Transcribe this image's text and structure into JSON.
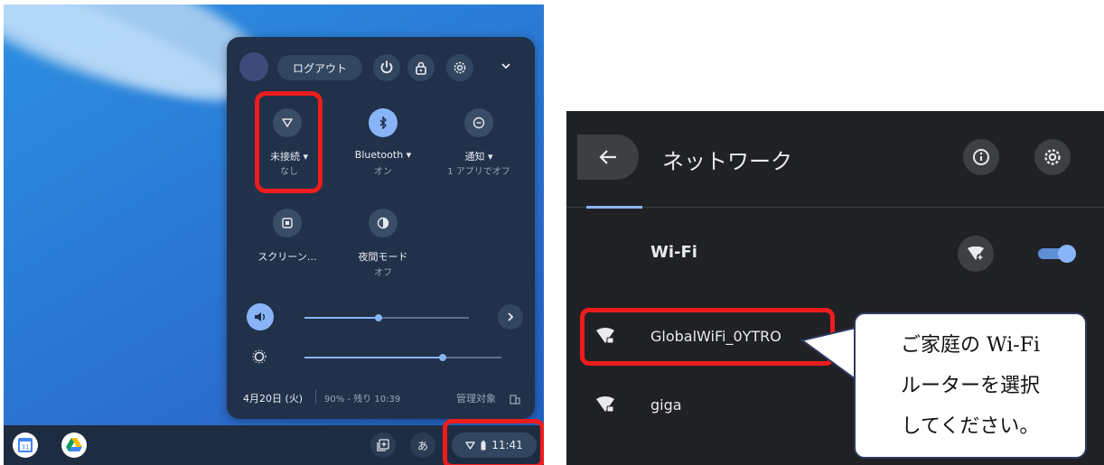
{
  "left_panel": {
    "header": {
      "logout_label": "ログアウト",
      "icons": [
        "avatar",
        "power-icon",
        "lock-icon",
        "gear-icon",
        "chevron-down-icon"
      ]
    },
    "tiles": [
      {
        "label": "未接続 ▾",
        "sub": "なし",
        "icon": "wifi-icon",
        "active": false
      },
      {
        "label": "Bluetooth ▾",
        "sub": "オン",
        "icon": "bluetooth-icon",
        "active": true
      },
      {
        "label": "通知 ▾",
        "sub": "1 アプリでオフ",
        "icon": "notifications-off-icon",
        "active": false
      },
      {
        "label": "スクリーン…",
        "sub": "",
        "icon": "screen-capture-icon",
        "active": false
      },
      {
        "label": "夜間モード",
        "sub": "オフ",
        "icon": "night-light-icon",
        "active": false
      }
    ],
    "volume_level": 0.45,
    "brightness_level": 0.7,
    "status": {
      "date": "4月20日 (火)",
      "battery": "90% - 残り 10:39",
      "managed": "管理対象"
    },
    "shelf": {
      "time": "11:41",
      "ime": "あ"
    }
  },
  "right_panel": {
    "title": "ネットワーク",
    "wifi_label": "Wi-Fi",
    "wifi_enabled": true,
    "networks": [
      {
        "name": "GlobalWiFi_0YTRO",
        "secured": true
      },
      {
        "name": "giga",
        "secured": true
      }
    ]
  },
  "callout": {
    "line1": "ご家庭の Wi-Fi",
    "line2": "ルーターを選択",
    "line3": "してください。"
  },
  "colors": {
    "highlight": "#ee1c1c",
    "accent": "#8ab4f8",
    "panel_bg": "#21314a",
    "settings_bg": "#202124"
  }
}
